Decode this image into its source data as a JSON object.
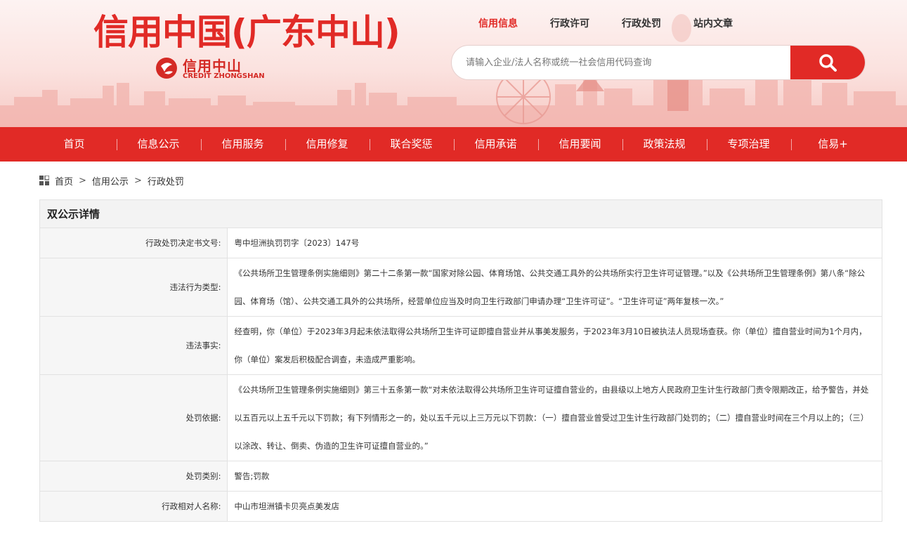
{
  "header": {
    "site_title": "信用中国(广东中山)",
    "logo_text_cn": "信用中山",
    "logo_text_en": "CREDIT ZHONGSHAN"
  },
  "search": {
    "tabs": [
      {
        "label": "信用信息",
        "active": true
      },
      {
        "label": "行政许可",
        "active": false
      },
      {
        "label": "行政处罚",
        "active": false
      },
      {
        "label": "站内文章",
        "active": false
      }
    ],
    "placeholder": "请输入企业/法人名称或统一社会信用代码查询"
  },
  "nav": {
    "items": [
      "首页",
      "信息公示",
      "信用服务",
      "信用修复",
      "联合奖惩",
      "信用承诺",
      "信用要闻",
      "政策法规",
      "专项治理",
      "信易+"
    ]
  },
  "breadcrumb": {
    "items": [
      "首页",
      "信用公示",
      "行政处罚"
    ],
    "separator": ">"
  },
  "detail": {
    "title": "双公示详情",
    "rows": [
      {
        "label": "行政处罚决定书文号:",
        "value": "粤中坦洲执罚罚字〔2023〕147号"
      },
      {
        "label": "违法行为类型:",
        "value": "《公共场所卫生管理条例实施细则》第二十二条第一款“国家对除公园、体育场馆、公共交通工具外的公共场所实行卫生许可证管理。”以及《公共场所卫生管理条例》第八条“除公园、体育场（馆）、公共交通工具外的公共场所，经营单位应当及时向卫生行政部门申请办理“卫生许可证”。“卫生许可证”两年复核一次。”"
      },
      {
        "label": "违法事实:",
        "value": "经查明，你（单位）于2023年3月起未依法取得公共场所卫生许可证即擅自营业并从事美发服务，于2023年3月10日被执法人员现场查获。你（单位）擅自营业时间为1个月内，你（单位）案发后积极配合调查，未造成严重影响。"
      },
      {
        "label": "处罚依据:",
        "value": "《公共场所卫生管理条例实施细则》第三十五条第一款“对未依法取得公共场所卫生许可证擅自营业的，由县级以上地方人民政府卫生计生行政部门责令限期改正，给予警告，并处以五百元以上五千元以下罚款；有下列情形之一的，处以五千元以上三万元以下罚款：（一）擅自营业曾受过卫生计生行政部门处罚的；（二）擅自营业时间在三个月以上的；（三）以涂改、转让、倒卖、伪造的卫生许可证擅自营业的。”"
      },
      {
        "label": "处罚类别:",
        "value": "警告;罚款"
      },
      {
        "label": "行政相对人名称:",
        "value": "中山市坦洲镇卡贝亮点美发店"
      }
    ]
  },
  "colors": {
    "brand_red": "#e12a26",
    "label_bg": "#f6f6f6",
    "border": "#e2e2e2"
  }
}
